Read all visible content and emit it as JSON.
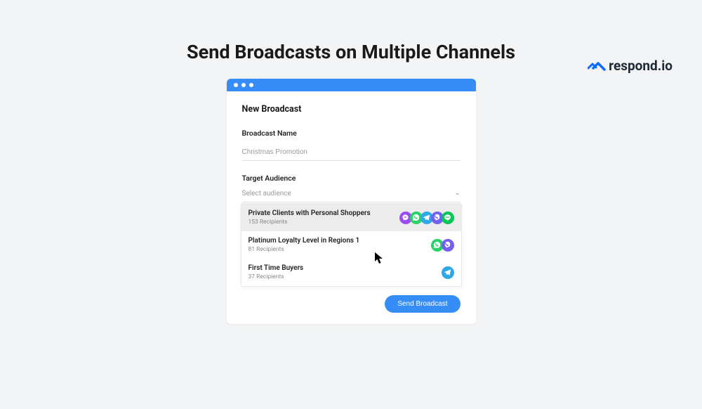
{
  "brand": "respond.io",
  "heading": "Send Broadcasts on Multiple Channels",
  "modal": {
    "title": "New Broadcast",
    "name_label": "Broadcast Name",
    "name_value": "Christmas Promotion",
    "audience_label": "Target Audience",
    "audience_placeholder": "Select audience",
    "submit": "Send Broadcast"
  },
  "options": [
    {
      "name": "Private Clients with Personal Shoppers",
      "count": "153 Recipients",
      "channels": [
        "messenger",
        "whatsapp",
        "telegram",
        "viber",
        "line"
      ]
    },
    {
      "name": "Platinum Loyalty Level in Regions 1",
      "count": "81 Recipients",
      "channels": [
        "whatsapp",
        "viber"
      ]
    },
    {
      "name": "First Time Buyers",
      "count": "37 Recipients",
      "channels": [
        "telegram"
      ]
    }
  ],
  "channel_colors": {
    "messenger": "#9b4df3",
    "whatsapp": "#25d366",
    "telegram": "#2fa8e8",
    "viber": "#7360f2",
    "line": "#06c755"
  }
}
